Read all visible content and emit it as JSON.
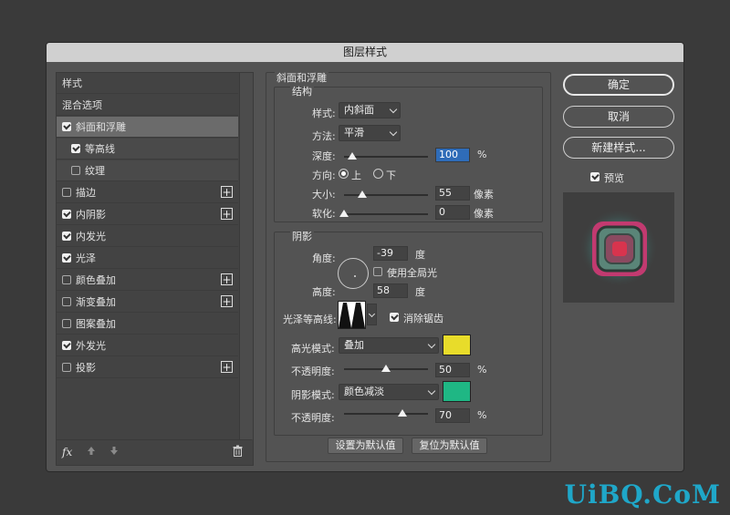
{
  "window": {
    "title": "图层样式"
  },
  "sidebar": {
    "header": "样式",
    "items": [
      {
        "label": "混合选项",
        "checkbox": false,
        "checked": false,
        "plus": false
      },
      {
        "label": "斜面和浮雕",
        "checkbox": true,
        "checked": true,
        "plus": false,
        "selected": true
      },
      {
        "label": "等高线",
        "checkbox": true,
        "checked": true,
        "plus": false,
        "sub": true
      },
      {
        "label": "纹理",
        "checkbox": true,
        "checked": false,
        "plus": false,
        "sub": true
      },
      {
        "label": "描边",
        "checkbox": true,
        "checked": false,
        "plus": true
      },
      {
        "label": "内阴影",
        "checkbox": true,
        "checked": true,
        "plus": true
      },
      {
        "label": "内发光",
        "checkbox": true,
        "checked": true,
        "plus": false
      },
      {
        "label": "光泽",
        "checkbox": true,
        "checked": true,
        "plus": false
      },
      {
        "label": "颜色叠加",
        "checkbox": true,
        "checked": false,
        "plus": true
      },
      {
        "label": "渐变叠加",
        "checkbox": true,
        "checked": false,
        "plus": true
      },
      {
        "label": "图案叠加",
        "checkbox": true,
        "checked": false,
        "plus": false
      },
      {
        "label": "外发光",
        "checkbox": true,
        "checked": true,
        "plus": false
      },
      {
        "label": "投影",
        "checkbox": true,
        "checked": false,
        "plus": true
      }
    ],
    "fx": "fx"
  },
  "bevel": {
    "title": "斜面和浮雕",
    "structure": {
      "title": "结构",
      "style_label": "样式:",
      "style_value": "内斜面",
      "technique_label": "方法:",
      "technique_value": "平滑",
      "depth_label": "深度:",
      "depth_value": "100",
      "depth_unit": "%",
      "depth_fraction": 0.1,
      "direction_label": "方向:",
      "up_label": "上",
      "down_label": "下",
      "direction": "上",
      "size_label": "大小:",
      "size_value": "55",
      "size_unit": "像素",
      "size_fraction": 0.22,
      "soften_label": "软化:",
      "soften_value": "0",
      "soften_unit": "像素",
      "soften_fraction": 0.0
    },
    "shading": {
      "title": "阴影",
      "angle_label": "角度:",
      "angle_value": "-39",
      "angle_unit": "度",
      "global_light_label": "使用全局光",
      "global_light": false,
      "altitude_label": "高度:",
      "altitude_value": "58",
      "altitude_unit": "度",
      "gloss_label": "光泽等高线:",
      "antialias_label": "消除锯齿",
      "antialias": true,
      "highlight_label": "高光模式:",
      "highlight_mode": "叠加",
      "highlight_color": "#e8dc2a",
      "highlight_opacity_label": "不透明度:",
      "highlight_opacity": "50",
      "highlight_fraction": 0.5,
      "shadow_label": "阴影模式:",
      "shadow_mode": "颜色减淡",
      "shadow_color": "#1fb784",
      "shadow_opacity_label": "不透明度:",
      "shadow_opacity": "70",
      "shadow_fraction": 0.7,
      "percent": "%"
    },
    "make_default": "设置为默认值",
    "reset_default": "复位为默认值"
  },
  "actions": {
    "ok": "确定",
    "cancel": "取消",
    "new_style": "新建样式...",
    "preview_label": "预览",
    "preview": true
  },
  "watermark": "UiBQ.CoM"
}
